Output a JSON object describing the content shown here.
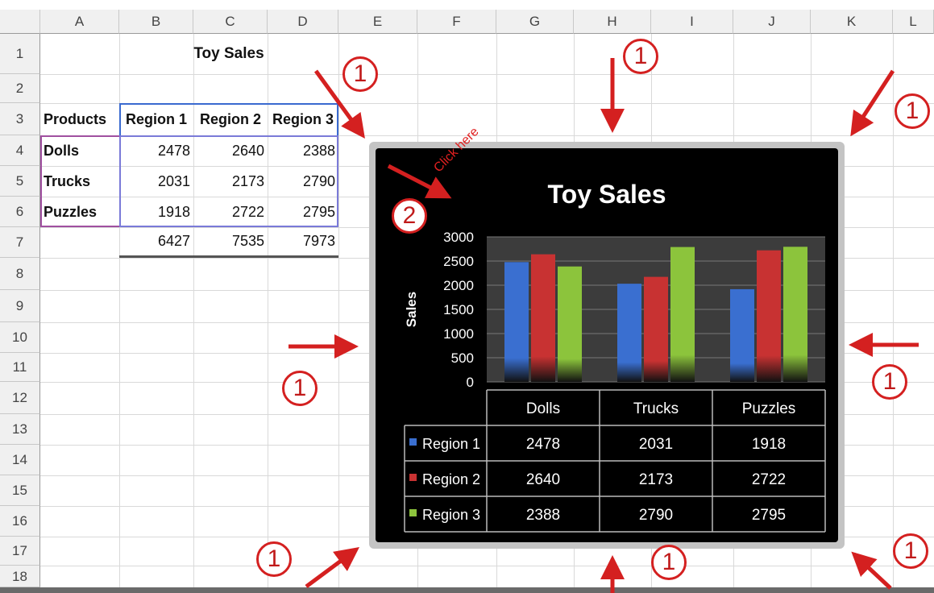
{
  "columns": [
    "A",
    "B",
    "C",
    "D",
    "E",
    "F",
    "G",
    "H",
    "I",
    "J",
    "K",
    "L"
  ],
  "rows": [
    "1",
    "2",
    "3",
    "4",
    "5",
    "6",
    "7",
    "8",
    "9",
    "10",
    "11",
    "12",
    "13",
    "14",
    "15",
    "16",
    "17",
    "18"
  ],
  "sheet": {
    "title": "Toy Sales",
    "header": [
      "Products",
      "Region 1",
      "Region 2",
      "Region 3"
    ],
    "data": [
      [
        "Dolls",
        "2478",
        "2640",
        "2388"
      ],
      [
        "Trucks",
        "2031",
        "2173",
        "2790"
      ],
      [
        "Puzzles",
        "1918",
        "2722",
        "2795"
      ]
    ],
    "totals": [
      "6427",
      "7535",
      "7973"
    ]
  },
  "annotations": {
    "step1": "1",
    "step2": "2",
    "click_text": "Click here",
    "accent": "#d42020"
  },
  "chart_data": {
    "type": "bar",
    "title": "Toy Sales",
    "ylabel": "Sales",
    "xlabel": "",
    "categories": [
      "Dolls",
      "Trucks",
      "Puzzles"
    ],
    "ylim": [
      0,
      3000
    ],
    "yticks": [
      0,
      500,
      1000,
      1500,
      2000,
      2500,
      3000
    ],
    "grid": true,
    "legend": "data-table",
    "series": [
      {
        "name": "Region 1",
        "color": "#3a6fd0",
        "values": [
          2478,
          2031,
          1918
        ]
      },
      {
        "name": "Region 2",
        "color": "#c83232",
        "values": [
          2640,
          2173,
          2722
        ]
      },
      {
        "name": "Region 3",
        "color": "#8cc43c",
        "values": [
          2388,
          2790,
          2795
        ]
      }
    ]
  }
}
